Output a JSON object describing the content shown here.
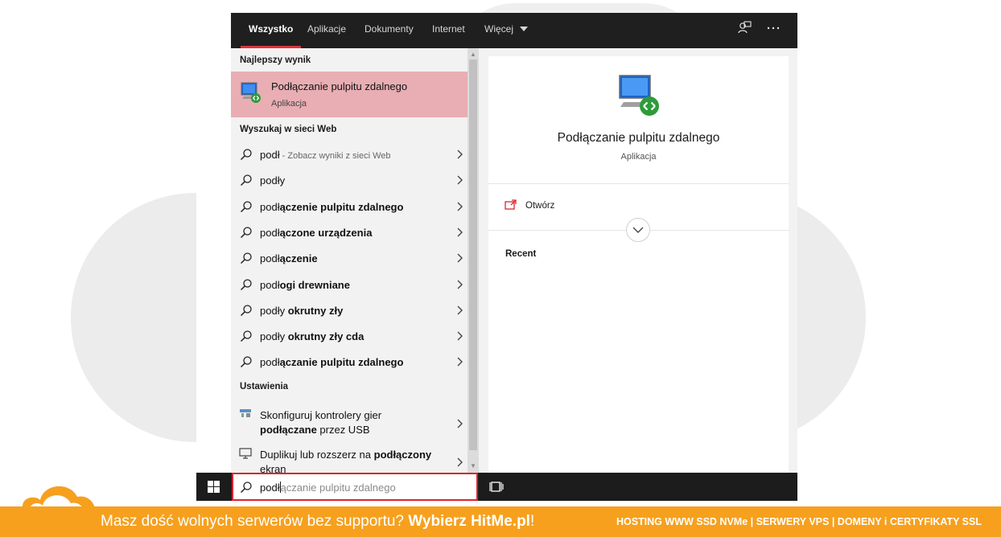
{
  "tabs": [
    {
      "label": "Wszystko"
    },
    {
      "label": "Aplikacje"
    },
    {
      "label": "Dokumenty"
    },
    {
      "label": "Internet"
    },
    {
      "label": "Więcej"
    }
  ],
  "sections": {
    "best_match": "Najlepszy wynik",
    "web": "Wyszukaj w sieci Web",
    "settings": "Ustawienia"
  },
  "best_result": {
    "title": "Podłączanie pulpitu zdalnego",
    "subtitle": "Aplikacja"
  },
  "web_results": [
    {
      "prefix": "podł",
      "bold": "",
      "hint": " - Zobacz wyniki z sieci Web"
    },
    {
      "prefix": "podły",
      "bold": "",
      "hint": ""
    },
    {
      "prefix": "podł",
      "bold": "ączenie pulpitu zdalnego",
      "hint": ""
    },
    {
      "prefix": "podł",
      "bold": "ączone urządzenia",
      "hint": ""
    },
    {
      "prefix": "podł",
      "bold": "ączenie",
      "hint": ""
    },
    {
      "prefix": "podł",
      "bold": "ogi drewniane",
      "hint": ""
    },
    {
      "prefix": "podły",
      "bold": " okrutny zły",
      "hint": ""
    },
    {
      "prefix": "podły",
      "bold": " okrutny zły cda",
      "hint": ""
    },
    {
      "prefix": "podł",
      "bold": "ączanie pulpitu zdalnego",
      "hint": ""
    }
  ],
  "settings_results": [
    {
      "line1": "Skonfiguruj kontrolery gier",
      "line2_bold": "podłączane",
      "line2_rest": " przez USB"
    },
    {
      "line1_pre": "Duplikuj lub rozszerz na ",
      "line1_bold": "podłączony",
      "line2": "ekran"
    }
  ],
  "preview": {
    "title": "Podłączanie pulpitu zdalnego",
    "subtitle": "Aplikacja",
    "open_label": "Otwórz",
    "recent_label": "Recent"
  },
  "search": {
    "typed": "podł",
    "ghost": "ączanie pulpitu zdalnego"
  },
  "banner": {
    "text": "Masz dość wolnych serwerów bez supportu? ",
    "brand": "Wybierz HitMe.pl",
    "excl": "!",
    "right": "HOSTING WWW SSD NVMe | SERWERY VPS | DOMENY i CERTYFIKATY SSL"
  },
  "icons": {
    "feedback": "feedback-icon",
    "more": "more-icon",
    "windows": "windows-start-icon",
    "taskview": "task-view-icon"
  },
  "colors": {
    "accent": "#e0313a",
    "best_bg": "#e8aeb3",
    "banner": "#f6a01e"
  }
}
